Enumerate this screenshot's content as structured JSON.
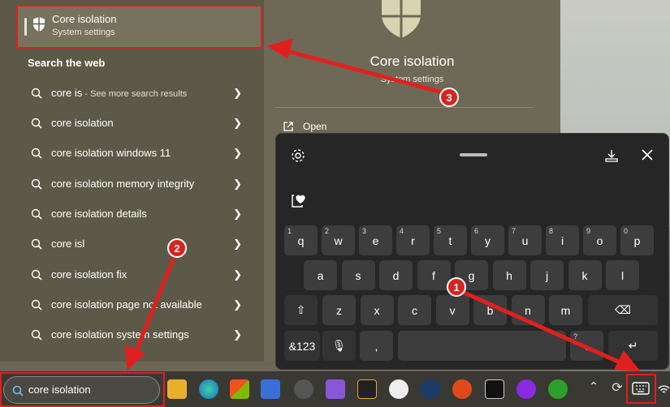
{
  "best_match": {
    "title": "Core isolation",
    "subtitle": "System settings"
  },
  "web_section_title": "Search the web",
  "web_results": [
    {
      "main": "core is",
      "hint": " - See more search results"
    },
    {
      "main": "core isolation",
      "hint": ""
    },
    {
      "main": "core isolation windows 11",
      "hint": ""
    },
    {
      "main": "core isolation memory integrity",
      "hint": ""
    },
    {
      "main": "core isolation details",
      "hint": ""
    },
    {
      "main": "core isl",
      "hint": ""
    },
    {
      "main": "core isolation fix",
      "hint": ""
    },
    {
      "main": "core isolation page not available",
      "hint": ""
    },
    {
      "main": "core isolation system settings",
      "hint": ""
    }
  ],
  "preview": {
    "title": "Core isolation",
    "subtitle": "System settings",
    "open_label": "Open"
  },
  "keyboard": {
    "row1": [
      {
        "k": "q",
        "n": "1"
      },
      {
        "k": "w",
        "n": "2"
      },
      {
        "k": "e",
        "n": "3"
      },
      {
        "k": "r",
        "n": "4"
      },
      {
        "k": "t",
        "n": "5"
      },
      {
        "k": "y",
        "n": "6"
      },
      {
        "k": "u",
        "n": "7"
      },
      {
        "k": "i",
        "n": "8"
      },
      {
        "k": "o",
        "n": "9"
      },
      {
        "k": "p",
        "n": "0"
      }
    ],
    "row2": [
      "a",
      "s",
      "d",
      "f",
      "g",
      "h",
      "j",
      "k",
      "l"
    ],
    "row3": [
      "z",
      "x",
      "c",
      "v",
      "b",
      "n",
      "m"
    ],
    "sym_label": "&123",
    "comma": ",",
    "period": ".",
    "period_alt": "?"
  },
  "taskbar": {
    "search_value": "core isolation"
  },
  "annotations": {
    "b1": "1",
    "b2": "2",
    "b3": "3"
  },
  "colors": {
    "accent_red": "#e0201e",
    "keyboard_bg": "#262626",
    "key_bg": "#3d3d3d"
  }
}
